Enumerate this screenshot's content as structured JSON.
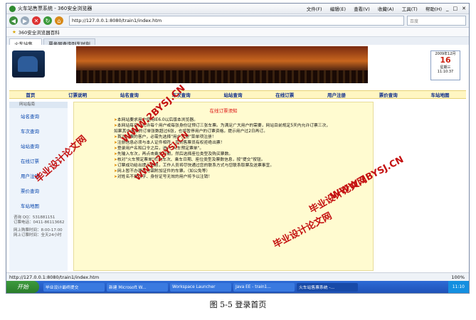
{
  "browser": {
    "title": "火车站售票系统 - 360安全浏览器",
    "menus": [
      "文件(F)",
      "编辑(E)",
      "查看(V)",
      "收藏(A)",
      "工具(T)",
      "帮助(H)"
    ],
    "address": "http://127.0.0.1:8080/train1/index.htm",
    "search_placeholder": "百度",
    "favorite": "360安全浏览器百科",
    "tabs": [
      "火车站售...",
      "票务网查询列车时刻"
    ]
  },
  "header": {
    "date_label": "2009年12月",
    "day": "16",
    "weekday": "星期三",
    "time": "11:10:37"
  },
  "nav": [
    "首页",
    "订票说明",
    "站名查询",
    "车次查询",
    "站站查询",
    "在线订票",
    "用户注册",
    "票价查询",
    "车站地图"
  ],
  "sidebar": {
    "header": "网站指南",
    "items": [
      "站名查询",
      "车次查询",
      "站站查询",
      "在线订票",
      "用户注册",
      "票价查询",
      "车站地图"
    ],
    "contact": [
      "咨询 QQ：531881151",
      "订票电话：0411-86113662"
    ],
    "hours": [
      "网上购票时间：8:00-17:00",
      "网上订票时间：全天24小时"
    ]
  },
  "content": {
    "title": "在线订票须知",
    "lines": [
      "本网站要求用户使用IE6.0以后版本浏览器。",
      "本网站每日只允许每个用户或每张身份证预订三张车票。为满足广大用户的需要，网站目前规定5天内允许订票三次，如果其中未取的订单张数超过6张，也将暂停用户的订票资格，提示用户过2日再订。",
      "首次订票的客户，必需先选择\"用户注册\"菜单项注册！",
      "注册信息必须与本人证件相符，否则售票员有权拒绝出票！",
      "登录用户名和口令之后，进入\"火车预定票单\"。",
      "先输入车次，再点击乘车日期，然后选择座位类型及购买票数。",
      "核对\"火车预定票单\"栏内车次、乘车日期、座位类型及票数信息，按\"提交\"按钮。",
      "订票成功给出提示信息，工作人员将尽快通过您的联系方式与您联系取票及送票事宜。",
      "网上暂不办理其他需附加证件的车票。（如公免等）",
      "对姓名不是汉字、身份证号无效的用户将予以注销！"
    ]
  },
  "watermarks": [
    "毕业设计论文网",
    "WWW.2BYSJ.CN",
    "毕业设计论文网",
    "WWW.2BYSJ.CN",
    "毕业设计论文网",
    "WWW.2BYSJ.CN"
  ],
  "status": {
    "url": "http://127.0.0.1:8080/train1/index.htm",
    "zoom": "100%"
  },
  "taskbar": {
    "start": "开始",
    "tasks": [
      "毕业设计最终提交",
      "新建 Microsoft W...",
      "Workspace Launcher",
      "Java EE - train1...",
      "火车站售票系统 -..."
    ],
    "clock": "11:10"
  },
  "caption": "图 5-5  登录首页"
}
